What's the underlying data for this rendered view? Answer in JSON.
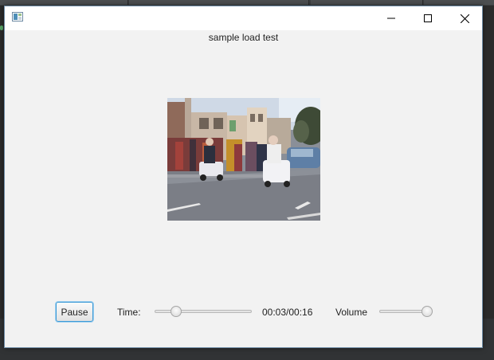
{
  "window": {
    "title": "sample load test",
    "controls": {
      "minimize": "minimize-icon",
      "maximize": "maximize-icon",
      "close": "close-icon"
    }
  },
  "player": {
    "pause_label": "Pause",
    "time_label": "Time:",
    "time_readout": "00:03/00:16",
    "time_progress": 0.1875,
    "volume_label": "Volume",
    "volume_level": 1.0
  },
  "colors": {
    "window_bg": "#f2f2f2",
    "focus_accent": "#3d9ad6"
  }
}
